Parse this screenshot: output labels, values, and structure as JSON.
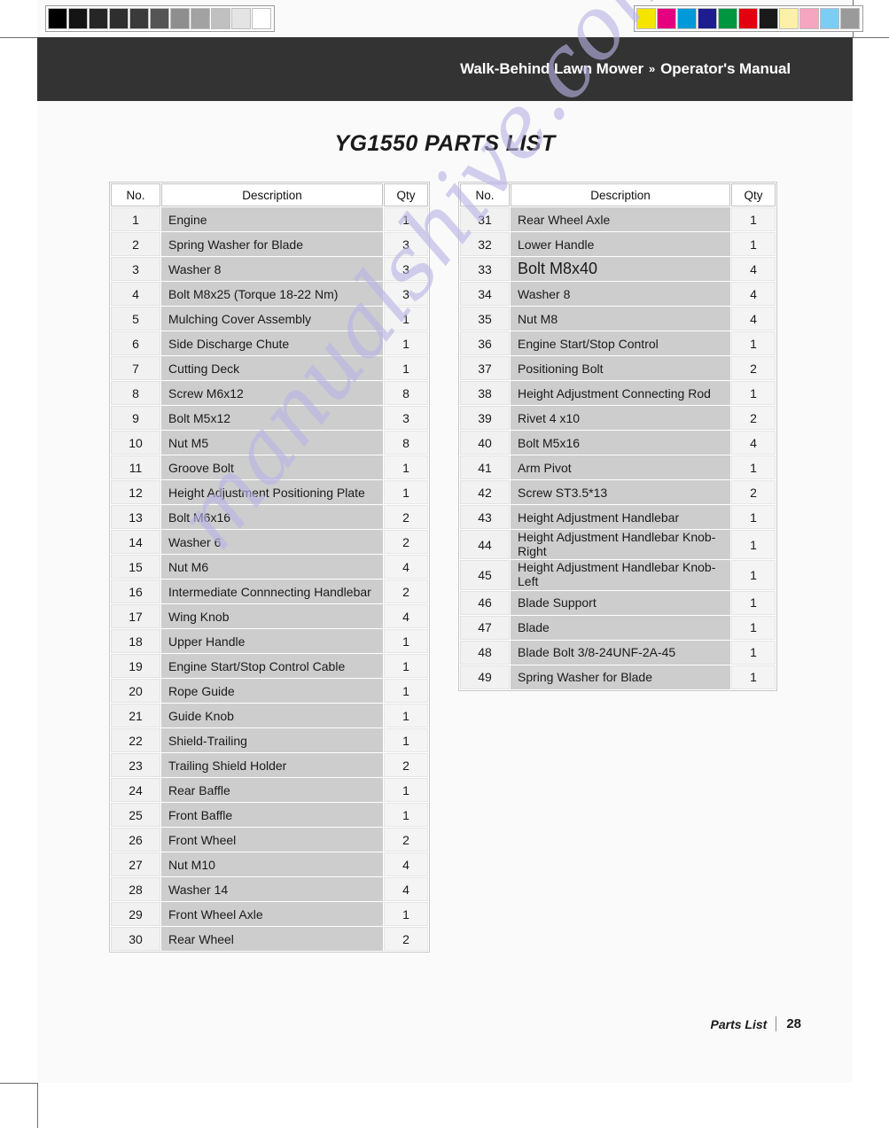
{
  "header": {
    "product": "Walk-Behind Lawn Mower",
    "separator": "»",
    "doc_type": "Operator's Manual"
  },
  "page_title": "YG1550 PARTS LIST",
  "watermark": {
    "text": "manualshive.com",
    "color": "#b9b4e6"
  },
  "footer": {
    "section": "Parts List",
    "page_number": "28"
  },
  "calibration": {
    "greyscale_label": "greyscale-calibration-strip",
    "greyscale_swatches": [
      "#000000",
      "#141414",
      "#262626",
      "#2e2e2e",
      "#3a3a3a",
      "#555555",
      "#8e8e8e",
      "#a2a2a2",
      "#c0c0c0",
      "#e4e4e4",
      "#ffffff"
    ],
    "color_label": "color-calibration-strip",
    "color_swatches": [
      "#f5e400",
      "#e4007f",
      "#0099d9",
      "#1d1d8f",
      "#009640",
      "#e3000f",
      "#1a1a1a",
      "#fdf0a8",
      "#f6a5c0",
      "#7ccdf4",
      "#9a9a9a"
    ]
  },
  "tables": {
    "columns": [
      "No.",
      "Description",
      "Qty"
    ],
    "left": [
      {
        "no": "1",
        "desc": "Engine",
        "qty": "1"
      },
      {
        "no": "2",
        "desc": "Spring Washer for Blade",
        "qty": "3"
      },
      {
        "no": "3",
        "desc": "Washer 8",
        "qty": "3"
      },
      {
        "no": "4",
        "desc": "Bolt M8x25 (Torque 18-22 Nm)",
        "qty": "3"
      },
      {
        "no": "5",
        "desc": "Mulching Cover Assembly",
        "qty": "1"
      },
      {
        "no": "6",
        "desc": "Side Discharge Chute",
        "qty": "1"
      },
      {
        "no": "7",
        "desc": "Cutting Deck",
        "qty": "1"
      },
      {
        "no": "8",
        "desc": "Screw M6x12",
        "qty": "8"
      },
      {
        "no": "9",
        "desc": "Bolt M5x12",
        "qty": "3"
      },
      {
        "no": "10",
        "desc": "Nut M5",
        "qty": "8"
      },
      {
        "no": "11",
        "desc": "Groove Bolt",
        "qty": "1"
      },
      {
        "no": "12",
        "desc": "Height Adjustment Positioning Plate",
        "qty": "1"
      },
      {
        "no": "13",
        "desc": "Bolt M6x16",
        "qty": "2"
      },
      {
        "no": "14",
        "desc": "Washer 6",
        "qty": "2"
      },
      {
        "no": "15",
        "desc": "Nut M6",
        "qty": "4"
      },
      {
        "no": "16",
        "desc": "Intermediate Connnecting Handlebar",
        "qty": "2"
      },
      {
        "no": "17",
        "desc": "Wing Knob",
        "qty": "4"
      },
      {
        "no": "18",
        "desc": "Upper Handle",
        "qty": "1"
      },
      {
        "no": "19",
        "desc": "Engine Start/Stop Control Cable",
        "qty": "1"
      },
      {
        "no": "20",
        "desc": "Rope Guide",
        "qty": "1"
      },
      {
        "no": "21",
        "desc": "Guide Knob",
        "qty": "1"
      },
      {
        "no": "22",
        "desc": "Shield-Trailing",
        "qty": "1"
      },
      {
        "no": "23",
        "desc": "Trailing Shield Holder",
        "qty": "2"
      },
      {
        "no": "24",
        "desc": "Rear Baffle",
        "qty": "1"
      },
      {
        "no": "25",
        "desc": "Front Baffle",
        "qty": "1"
      },
      {
        "no": "26",
        "desc": "Front Wheel",
        "qty": "2"
      },
      {
        "no": "27",
        "desc": "Nut M10",
        "qty": "4"
      },
      {
        "no": "28",
        "desc": "Washer 14",
        "qty": "4"
      },
      {
        "no": "29",
        "desc": "Front Wheel Axle",
        "qty": "1"
      },
      {
        "no": "30",
        "desc": "Rear Wheel",
        "qty": "2"
      }
    ],
    "right": [
      {
        "no": "31",
        "desc": "Rear Wheel Axle",
        "qty": "1"
      },
      {
        "no": "32",
        "desc": "Lower Handle",
        "qty": "1"
      },
      {
        "no": "33",
        "desc": "Bolt M8x40",
        "qty": "4",
        "style": "big"
      },
      {
        "no": "34",
        "desc": "Washer 8",
        "qty": "4"
      },
      {
        "no": "35",
        "desc": "Nut M8",
        "qty": "4"
      },
      {
        "no": "36",
        "desc": "Engine Start/Stop Control",
        "qty": "1"
      },
      {
        "no": "37",
        "desc": "Positioning Bolt",
        "qty": "2"
      },
      {
        "no": "38",
        "desc": "Height Adjustment Connecting Rod",
        "qty": "1"
      },
      {
        "no": "39",
        "desc": "Rivet 4 x10",
        "qty": "2"
      },
      {
        "no": "40",
        "desc": "Bolt M5x16",
        "qty": "4"
      },
      {
        "no": "41",
        "desc": "Arm Pivot",
        "qty": "1"
      },
      {
        "no": "42",
        "desc": "Screw ST3.5*13",
        "qty": "2"
      },
      {
        "no": "43",
        "desc": "Height Adjustment Handlebar",
        "qty": "1"
      },
      {
        "no": "44",
        "desc": "Height Adjustment Handlebar Knob-Right",
        "qty": "1",
        "style": "two-line"
      },
      {
        "no": "45",
        "desc": "Height Adjustment Handlebar Knob-Left",
        "qty": "1",
        "style": "two-line"
      },
      {
        "no": "46",
        "desc": "Blade Support",
        "qty": "1"
      },
      {
        "no": "47",
        "desc": "Blade",
        "qty": "1"
      },
      {
        "no": "48",
        "desc": "Blade Bolt 3/8-24UNF-2A-45",
        "qty": "1"
      },
      {
        "no": "49",
        "desc": "Spring Washer for Blade",
        "qty": "1"
      }
    ]
  }
}
